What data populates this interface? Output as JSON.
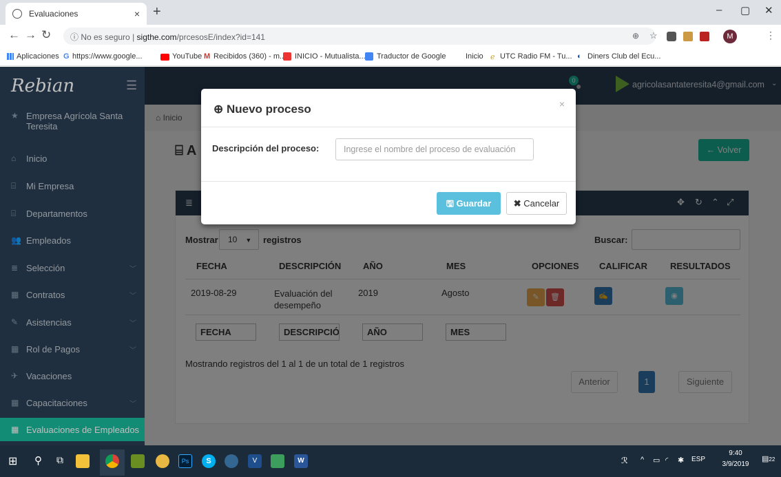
{
  "browser": {
    "tab_title": "Evaluaciones",
    "tab_close": "×",
    "new_tab": "+",
    "url_prefix": "ⓘ No es seguro",
    "url_sep": "|",
    "url_domain": "sigthe.com",
    "url_path": "/prcesosE/index?id=141",
    "profile_initial": "M",
    "bookmarks": [
      "Aplicaciones",
      "https://www.google...",
      "YouTube",
      "Recibidos (360) - m...",
      "INICIO - Mutualista...",
      "Traductor de Google",
      "Inicio",
      "UTC Radio FM - Tu...",
      "Diners Club del Ecu..."
    ]
  },
  "sidebar": {
    "logo": "Rebian",
    "items": [
      {
        "label": "Empresa Agrícola Santa Teresita",
        "icon": "star-icon"
      },
      {
        "label": "Inicio",
        "icon": "home-icon"
      },
      {
        "label": "Mi Empresa",
        "icon": "bank-icon"
      },
      {
        "label": "Departamentos",
        "icon": "bank-icon"
      },
      {
        "label": "Empleados",
        "icon": "users-icon"
      },
      {
        "label": "Selección",
        "icon": "list-icon"
      },
      {
        "label": "Contratos",
        "icon": "table-icon"
      },
      {
        "label": "Asistencias",
        "icon": "edit-icon"
      },
      {
        "label": "Rol de Pagos",
        "icon": "table-icon"
      },
      {
        "label": "Vacaciones",
        "icon": "plane-icon"
      },
      {
        "label": "Capacitaciones",
        "icon": "table-icon"
      },
      {
        "label": "Evaluaciones de Empleados",
        "icon": "table-icon"
      }
    ]
  },
  "topbar": {
    "notif_count": "0",
    "user_email": "agricolasantateresita4@gmail.com"
  },
  "content": {
    "breadcrumb": "Inicio",
    "page_title_initial": "A",
    "back_button": "Volver",
    "show_label": "Mostrar",
    "show_value": "10",
    "records_label": "registros",
    "search_label": "Buscar:",
    "columns": [
      "FECHA",
      "DESCRIPCIÓN",
      "AÑO",
      "MES",
      "OPCIONES",
      "CALIFICAR",
      "RESULTADOS"
    ],
    "row": {
      "fecha": "2019-08-29",
      "descripcion": "Evaluación del desempeño",
      "anio": "2019",
      "mes": "Agosto"
    },
    "filters": [
      "FECHA",
      "DESCRIPCIÓI",
      "AÑO",
      "MES"
    ],
    "info": "Mostrando registros del 1 al 1 de un total de 1 registros",
    "prev": "Anterior",
    "page": "1",
    "next": "Siguiente"
  },
  "modal": {
    "title": "Nuevo proceso",
    "close": "×",
    "label": "Descripción del proceso:",
    "placeholder": "Ingrese el nombre del proceso de evaluación",
    "save": "Guardar",
    "cancel": "Cancelar"
  },
  "taskbar": {
    "lang": "ESP",
    "time": "9:40",
    "date": "3/9/2019",
    "notif_count": "22"
  },
  "colors": {
    "sidebar": "#2a3f54",
    "accent": "#1abb9c",
    "info": "#5bc0de",
    "warning": "#f0ad4e",
    "danger": "#d9534f"
  }
}
